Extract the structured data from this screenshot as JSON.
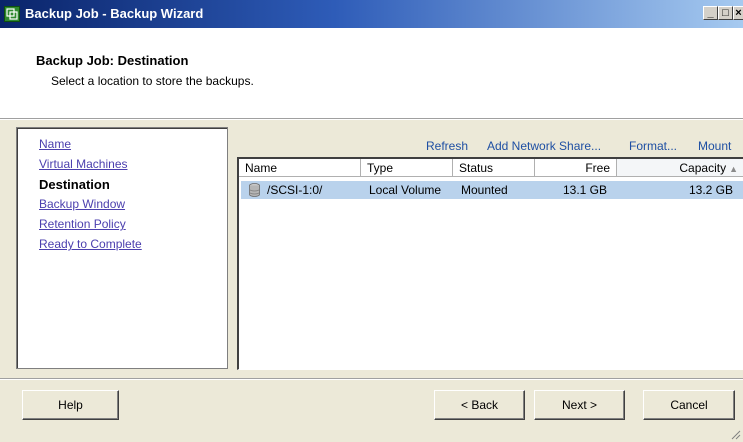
{
  "window": {
    "title": "Backup Job - Backup Wizard",
    "min_label": "_",
    "max_label": "□",
    "close_label": "×"
  },
  "header": {
    "step_title": "Backup Job: Destination",
    "step_description": "Select a location to store the backups."
  },
  "nav": {
    "items": [
      {
        "label": "Name",
        "state": "link"
      },
      {
        "label": "Virtual Machines",
        "state": "link"
      },
      {
        "label": "Destination",
        "state": "current"
      },
      {
        "label": "Backup Window",
        "state": "link"
      },
      {
        "label": "Retention Policy",
        "state": "link"
      },
      {
        "label": "Ready to Complete",
        "state": "link"
      }
    ]
  },
  "toolbar": {
    "refresh": "Refresh",
    "add_network_share": "Add Network Share...",
    "format": "Format...",
    "mount": "Mount"
  },
  "table": {
    "columns": [
      "Name",
      "Type",
      "Status",
      "Free",
      "Capacity"
    ],
    "sorted_column": "Capacity",
    "rows": [
      {
        "name": "/SCSI-1:0/",
        "type": "Local Volume",
        "status": "Mounted",
        "free": "13.1 GB",
        "capacity": "13.2 GB",
        "selected": true,
        "icon": "disk-icon"
      }
    ]
  },
  "buttons": {
    "help": "Help",
    "back": "< Back",
    "next": "Next >",
    "cancel": "Cancel"
  },
  "colors": {
    "title_bar_start": "#0a246a",
    "title_bar_end": "#a6caf0",
    "link": "#4b3fae",
    "selection": "#b9d2ec",
    "dialog_bg": "#ece9d8"
  }
}
